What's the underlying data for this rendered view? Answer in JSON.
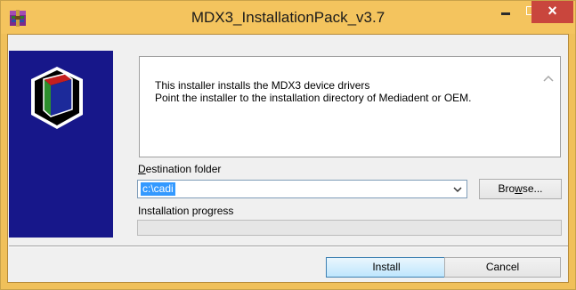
{
  "window": {
    "title": "MDX3_InstallationPack_v3.7",
    "accent_color": "#f4c45e",
    "icons": {
      "app": "winrar-archive-icon",
      "minimize": "minimize-icon",
      "maximize": "maximize-icon",
      "close": "close-icon"
    }
  },
  "side_panel": {
    "background": "#17178a",
    "logo": "cube-logo-icon"
  },
  "info": {
    "lines": [
      "This installer installs the MDX3 device drivers",
      "Point the installer to the installation directory of Mediadent or OEM."
    ],
    "scroll_icon": "chevron-up-icon"
  },
  "destination": {
    "label_prefix": "",
    "label_accel": "D",
    "label_rest": "estination folder",
    "value": "c:\\cadi",
    "dropdown_icon": "chevron-down-icon"
  },
  "browse": {
    "label_pre": "Bro",
    "label_accel": "w",
    "label_post": "se..."
  },
  "progress": {
    "label": "Installation progress",
    "value": 0
  },
  "buttons": {
    "install": "Install",
    "cancel": "Cancel"
  }
}
